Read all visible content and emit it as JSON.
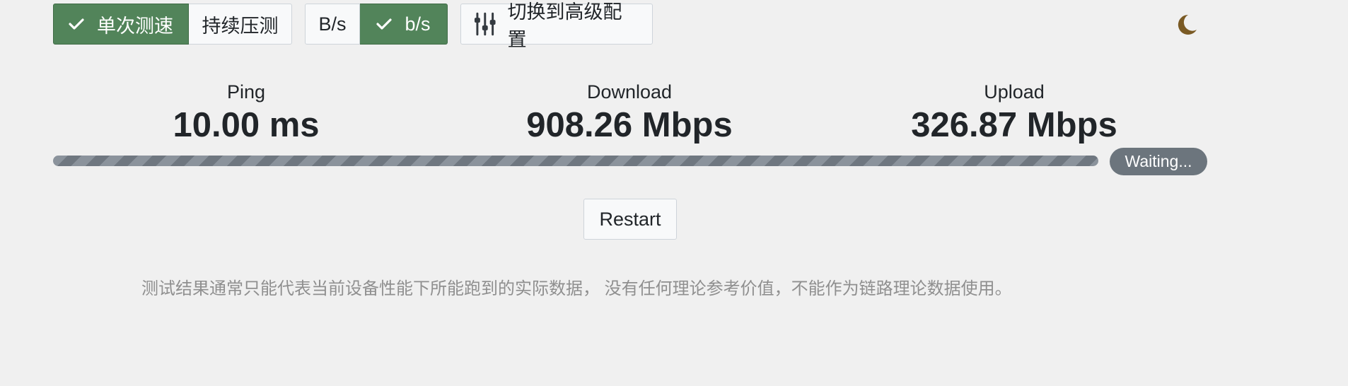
{
  "toolbar": {
    "mode_group": {
      "single_label": "单次测速",
      "continuous_label": "持续压测",
      "active": "single"
    },
    "unit_group": {
      "bytes_label": "B/s",
      "bits_label": "b/s",
      "active": "bits"
    },
    "advanced_label": "切换到高级配置"
  },
  "theme_toggle_icon": "moon-icon",
  "stats": {
    "ping": {
      "label": "Ping",
      "value": "10.00 ms"
    },
    "download": {
      "label": "Download",
      "value": "908.26 Mbps"
    },
    "upload": {
      "label": "Upload",
      "value": "326.87 Mbps"
    }
  },
  "progress": {
    "status": "Waiting..."
  },
  "restart_label": "Restart",
  "disclaimer": "测试结果通常只能代表当前设备性能下所能跑到的实际数据， 没有任何理论参考价值，不能作为链路理论数据使用。",
  "colors": {
    "active_green": "#52845a",
    "moon": "#7a5a24",
    "badge": "#6c757d"
  }
}
